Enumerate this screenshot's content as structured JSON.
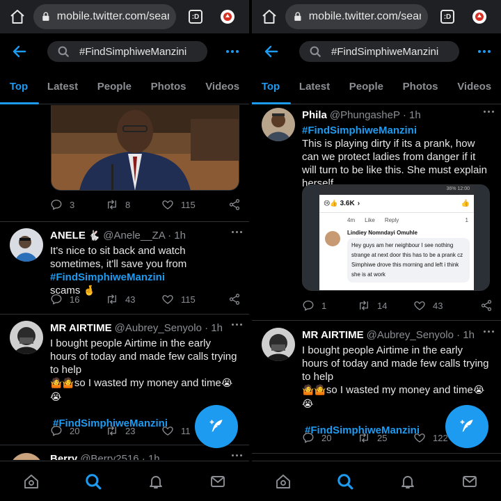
{
  "browser": {
    "url": "mobile.twitter.com/sear",
    "tabs_label": ":D"
  },
  "search": {
    "query": "#FindSimphiweManzini"
  },
  "tabs": [
    "Top",
    "Latest",
    "People",
    "Photos",
    "Videos"
  ],
  "left": {
    "tweet0": {
      "reply": "3",
      "retweet": "8",
      "like": "115"
    },
    "tweet1": {
      "name": "ANELE",
      "handle": "@Anele__ZA · 1h",
      "text1": "It's nice to sit back and watch sometimes, it'll  save you from ",
      "hashtag": "#FindSimphiweManzini",
      "text2": "scams",
      "reply": "16",
      "retweet": "43",
      "like": "115"
    },
    "tweet2": {
      "name": "MR AIRTIME",
      "handle": "@Aubrey_Senyolo · 1h",
      "text1": "I bought people Airtime in the early hours of today and made few calls trying to help",
      "text2": "so I wasted my money and time",
      "hashtag": "#FindSimphiweManzini",
      "reply": "20",
      "retweet": "23",
      "like": "11"
    },
    "tweet3": {
      "name": "Berry",
      "handle": "@Berry2516 · 1h"
    }
  },
  "right": {
    "tweet1": {
      "name": "Phila",
      "handle": "@PhungasheP · 1h",
      "hashtag": "#FindSimphiweManzini",
      "text": "This is playing dirty if its a prank, how can we protect ladies from danger if it will turn to be like this. She must explain herself.",
      "reply": "1",
      "retweet": "14",
      "like": "43",
      "media": {
        "status": "36%  12:00",
        "count": "3.6K",
        "meta_time": "4m",
        "meta_like": "Like",
        "meta_reply": "Reply",
        "meta_count": "1",
        "commenter": "Lindiey Nomndayi Omuhle",
        "comment": "Hey guys am her neighbour I see nothing strange at next door this has to be a prank cz Simphiwe drove this morning and left i think she is at work"
      }
    },
    "tweet2": {
      "name": "MR AIRTIME",
      "handle": "@Aubrey_Senyolo · 1h",
      "text1": "I bought people Airtime in the early hours of today and made few calls trying to help",
      "text2": "so I wasted my money and time",
      "hashtag": "#FindSimphiweManzini",
      "reply": "20",
      "retweet": "25",
      "like": "122"
    }
  },
  "colors": {
    "accent": "#1d9bf0",
    "bg": "#000000",
    "muted": "#8b8f94"
  }
}
